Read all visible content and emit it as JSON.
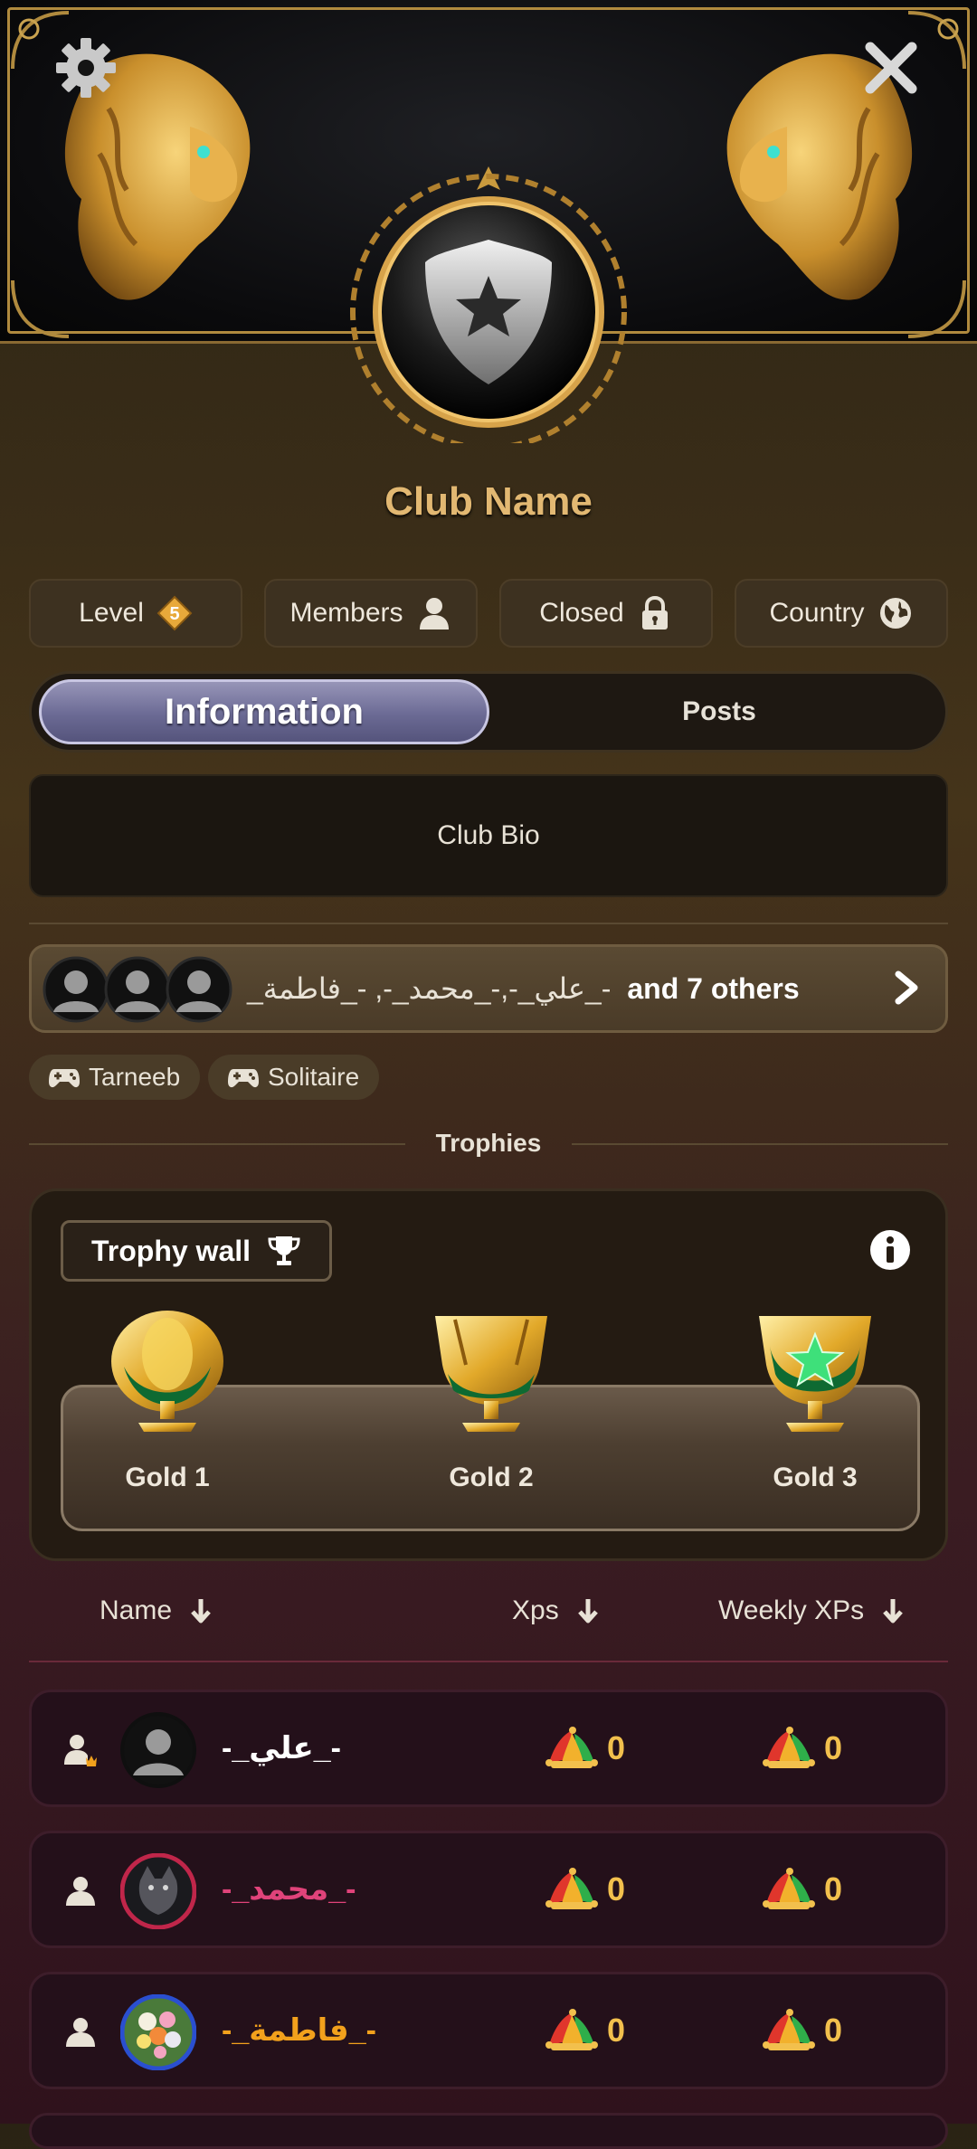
{
  "header": {
    "settings_icon": "gear-icon",
    "close_icon": "close-icon",
    "emblem": "club-shield-star-emblem"
  },
  "club": {
    "name": "Club Name"
  },
  "stats": [
    {
      "label": "Level",
      "icon": "level-diamond-icon",
      "value": "5"
    },
    {
      "label": "Members",
      "icon": "person-icon"
    },
    {
      "label": "Closed",
      "icon": "lock-icon"
    },
    {
      "label": "Country",
      "icon": "globe-icon"
    }
  ],
  "tabs": {
    "information": "Information",
    "posts": "Posts",
    "active": "information"
  },
  "bio": {
    "text": "Club Bio"
  },
  "members_strip": {
    "names": "-_علي_-,-_محمد_-, -_فاطمة_",
    "others": "and 7 others"
  },
  "games": [
    {
      "label": "Tarneeb",
      "icon": "gamepad-icon"
    },
    {
      "label": "Solitaire",
      "icon": "gamepad-icon"
    }
  ],
  "trophies": {
    "section_title": "Trophies",
    "wall_label": "Trophy wall",
    "items": [
      {
        "label": "Gold 1"
      },
      {
        "label": "Gold 2"
      },
      {
        "label": "Gold 3"
      }
    ]
  },
  "table": {
    "headers": {
      "name": "Name",
      "xps": "Xps",
      "weekly": "Weekly XPs"
    },
    "rows": [
      {
        "name": "-_علي_-",
        "name_color": "#ffffff",
        "role": "owner",
        "xps": "0",
        "weekly": "0",
        "avatar_ring": "#0f0f0f"
      },
      {
        "name": "-_محمد_-",
        "name_color": "#e0437a",
        "role": "member",
        "xps": "0",
        "weekly": "0",
        "avatar_ring": "#c0264a"
      },
      {
        "name": "-_فاطمة_-",
        "name_color": "#f2a11c",
        "role": "member",
        "xps": "0",
        "weekly": "0",
        "avatar_ring": "#2a4fd0"
      }
    ]
  },
  "colors": {
    "accent_gold": "#e2b872",
    "tab_active": "#6b6a94",
    "xp_text": "#f2c04d"
  }
}
